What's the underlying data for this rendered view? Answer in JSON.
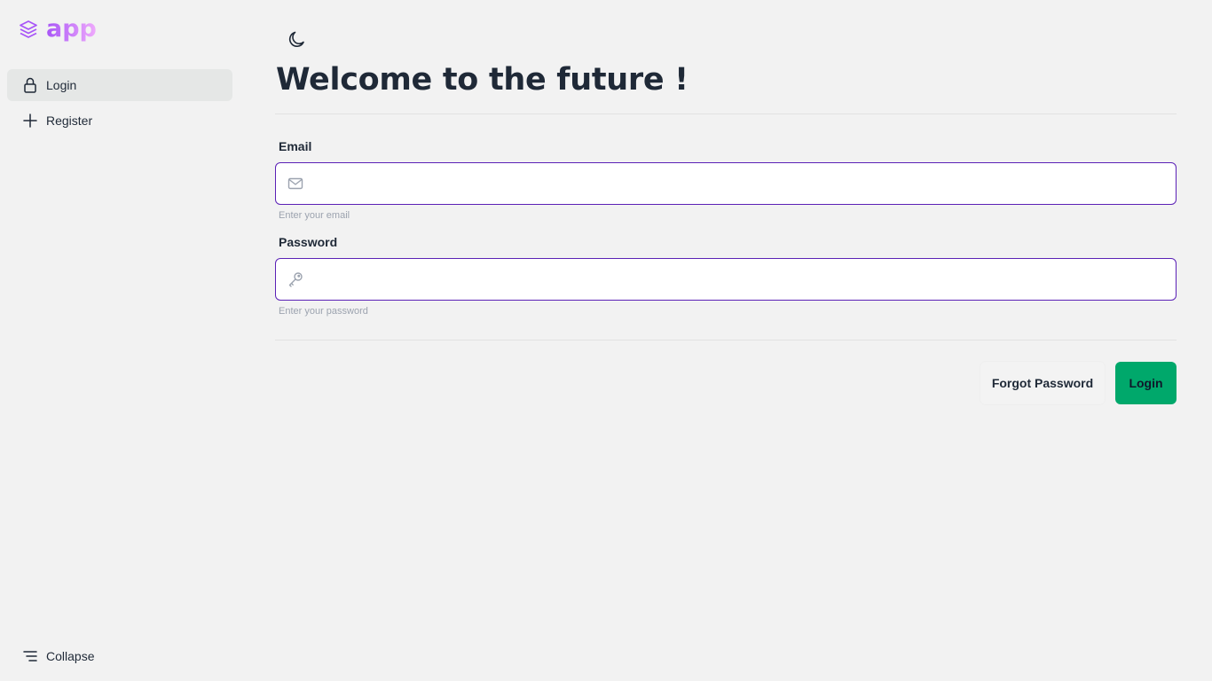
{
  "brand": {
    "name": "app",
    "icon": "layers-icon"
  },
  "sidebar": {
    "items": [
      {
        "label": "Login",
        "icon": "lock-icon",
        "active": true
      },
      {
        "label": "Register",
        "icon": "plus-icon",
        "active": false
      }
    ],
    "collapse_label": "Collapse",
    "collapse_icon": "menu-lines-icon"
  },
  "header": {
    "theme_icon": "moon-icon"
  },
  "main": {
    "title": "Welcome to the future !",
    "form": {
      "email": {
        "label": "Email",
        "value": "",
        "help": "Enter your email",
        "icon": "mail-icon"
      },
      "password": {
        "label": "Password",
        "value": "",
        "help": "Enter your password",
        "icon": "key-icon"
      }
    },
    "actions": {
      "forgot_label": "Forgot Password",
      "login_label": "Login"
    }
  },
  "colors": {
    "brand_gradient_start": "#a855f7",
    "brand_gradient_end": "#f0abfc",
    "input_border": "#5b21b6",
    "primary_button": "#00a86b",
    "background": "#f2f2f2"
  }
}
